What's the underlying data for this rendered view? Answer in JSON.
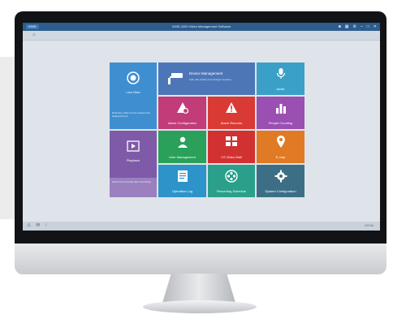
{
  "app": {
    "logo": "iVMS",
    "title": "iVMS-4200 Video Management Software",
    "window_controls": [
      "lock-icon",
      "grid-icon",
      "gear-icon",
      "minimize-icon",
      "maximize-icon",
      "close-icon"
    ]
  },
  "tabs": {
    "home_icon": "home-icon"
  },
  "tiles": {
    "live_view": {
      "label": "Live View",
      "desc": "Real-time video can be viewed and displayed here",
      "color": "#3f8fd0"
    },
    "device_management": {
      "label": "Device Management",
      "desc": "Add, edit, delete and configure devices",
      "color": "#4d76b8"
    },
    "audio": {
      "label": "Audio",
      "color": "#3aa0c8"
    },
    "alarm_configuration": {
      "label": "Alarm Configuration",
      "color": "#c23c79"
    },
    "alarm_records": {
      "label": "Alarm Records",
      "color": "#d93a34"
    },
    "people_counting": {
      "label": "People Counting",
      "color": "#9b4fb3"
    },
    "playback": {
      "label": "Playback",
      "desc": "Search for and play back recordings",
      "color": "#7f5aa8"
    },
    "user_management": {
      "label": "User Management",
      "color": "#2aa05a"
    },
    "cs_video_wall": {
      "label": "CS Video Wall",
      "color": "#d23131"
    },
    "e_map": {
      "label": "E-map",
      "color": "#e07a24"
    },
    "operation_log": {
      "label": "Operation Log",
      "color": "#2d94c9"
    },
    "recording_schedule": {
      "label": "Recording Schedule",
      "color": "#2a9f8a"
    },
    "system_configuration": {
      "label": "System Configuration",
      "color": "#3c6f86"
    }
  },
  "footer": {
    "icons": [
      "warning-icon",
      "chat-icon",
      "download-icon"
    ],
    "text": "100 Kb"
  }
}
